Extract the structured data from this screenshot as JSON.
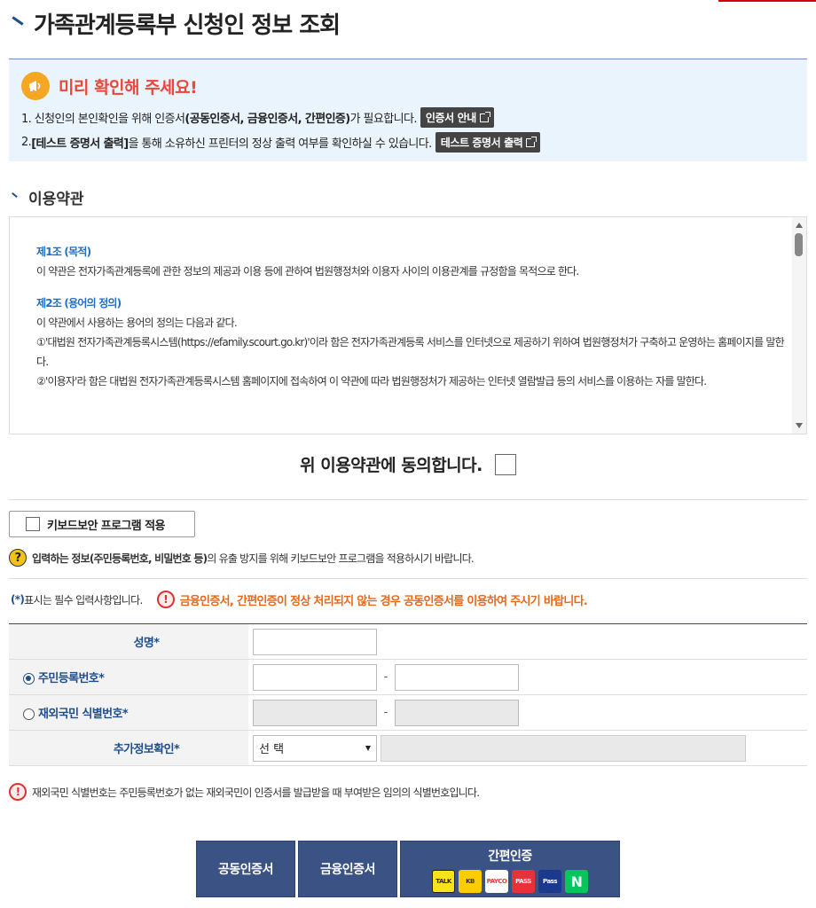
{
  "page": {
    "title": "가족관계등록부 신청인 정보 조회"
  },
  "notice": {
    "heading": "미리 확인해 주세요!",
    "line1_pre": "1. 신청인의 본인확인을 위해 인증서",
    "line1_bold": "(공동인증서, 금융인증서, 간편인증)",
    "line1_post": "가 필요합니다.",
    "line1_button": "인증서 안내",
    "line2_pre": "2. ",
    "line2_bold": "[테스트 증명서 출력]",
    "line2_post": "을 통해 소유하신 프린터의 정상 출력 여부를 확인하실 수 있습니다.",
    "line2_button": "테스트 증명서 출력"
  },
  "terms": {
    "section_title": "이용약관",
    "art1_title": "제1조 (목적)",
    "art1_text": "이 약관은 전자가족관계등록에 관한 정보의 제공과 이용 등에 관하여 법원행정처와 이용자 사이의 이용관계를 규정함을 목적으로 한다.",
    "art2_title": "제2조 (용어의 정의)",
    "art2_text": "이 약관에서 사용하는 용어의 정의는 다음과 같다.",
    "art2_item1": "①'대법원 전자가족관계등록시스템(https://efamily.scourt.go.kr)'이라 함은 전자가족관계등록 서비스를 인터넷으로 제공하기 위하여 법원행정처가 구축하고 운영하는 홈페이지를 말한다.",
    "art2_item2": "②'이용자'라 함은 대법원 전자가족관계등록시스템 홈페이지에 접속하여 이 약관에 따라 법원행정처가 제공하는 인터넷 열람발급 등의 서비스를 이용하는 자를 말한다.",
    "agree_label": "위 이용약관에 동의합니다."
  },
  "keyboard": {
    "button_label": "키보드보안 프로그램 적용",
    "hint_bold": "입력하는 정보(주민등록번호, 비밀번호 등)",
    "hint_rest": "의 유출 방지를 위해 키보드보안 프로그램을 적용하시기 바랍니다.",
    "hint_icon": "?"
  },
  "required": {
    "star": "(*)",
    "text": "표시는 필수 입력사항입니다.",
    "warn_icon": "!",
    "warning": "금융인증서, 간편인증이 정상 처리되지 않는 경우 공동인증서를 이용하여 주시기 바랍니다."
  },
  "form": {
    "name_label": "성명",
    "rrn_label": "주민등록번호",
    "foreign_label": "재외국민 식별번호",
    "extra_label": "추가정보확인",
    "star": "*",
    "dash": "-",
    "select_value": "선 택"
  },
  "footnote": {
    "icon": "!",
    "text": "재외국민 식별번호는 주민등록번호가 없는 재외국민이 인증서를 발급받을 때 부여받은 임의의 식별번호입니다."
  },
  "buttons": {
    "joint": "공동인증서",
    "finance": "금융인증서",
    "simple": "간편인증",
    "logos": {
      "kakao": "TALK",
      "kb": "KB",
      "payco": "PAYCO",
      "pass": "PASS",
      "spass": "Pass",
      "naver": "N"
    }
  },
  "colors": {
    "accent": "#1f4e8c",
    "warning": "#e8473b",
    "orange": "#e8681a",
    "button_bg": "#3b5384",
    "notice_bg": "#eaf4fc"
  }
}
